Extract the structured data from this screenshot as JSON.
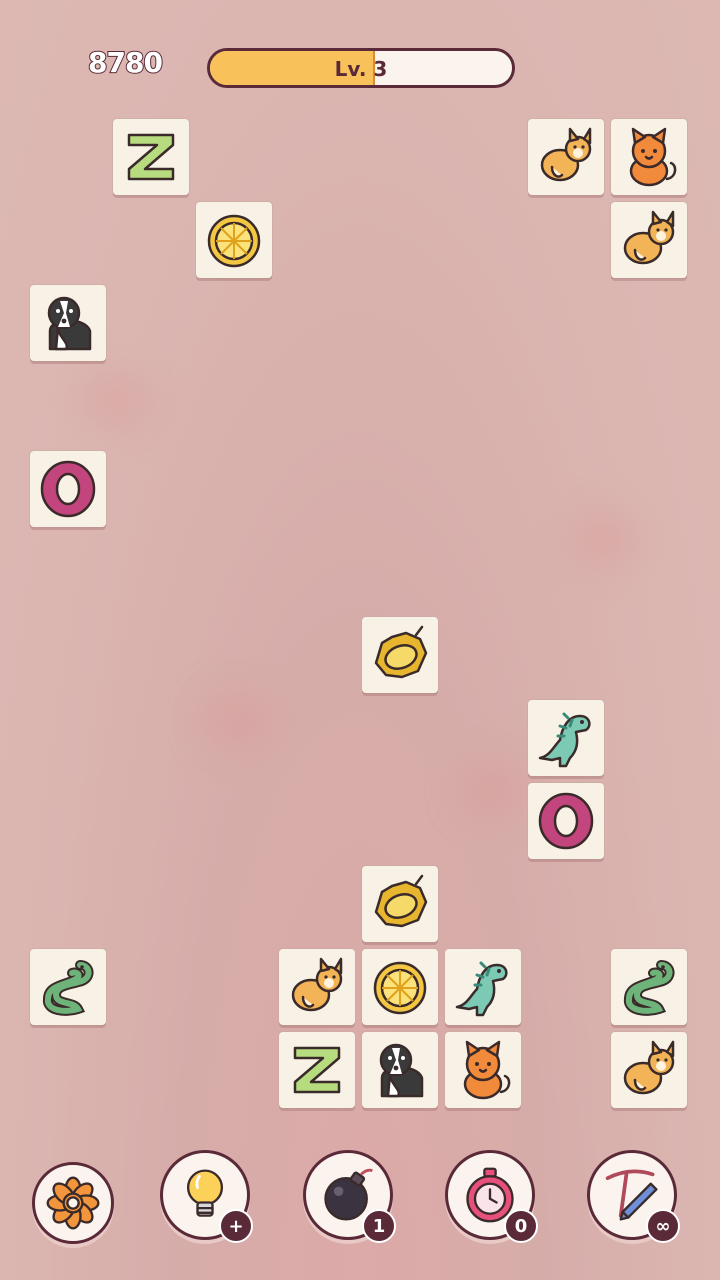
{
  "score": "8780",
  "level": {
    "label": "Lv. 3",
    "progress": 0.54
  },
  "tiles": [
    {
      "id": "t1",
      "col": 1,
      "row": 0,
      "icon": "letter-z-icon"
    },
    {
      "id": "t2",
      "col": 6,
      "row": 0,
      "icon": "corgi-icon"
    },
    {
      "id": "t3",
      "col": 7,
      "row": 0,
      "icon": "cat-icon"
    },
    {
      "id": "t4",
      "col": 2,
      "row": 1,
      "icon": "lemon-icon"
    },
    {
      "id": "t5",
      "col": 7,
      "row": 1,
      "icon": "corgi-icon"
    },
    {
      "id": "t6",
      "col": 0,
      "row": 2,
      "icon": "collie-icon"
    },
    {
      "id": "t7",
      "col": 0,
      "row": 4,
      "icon": "letter-o-icon"
    },
    {
      "id": "t8",
      "col": 4,
      "row": 6,
      "icon": "durian-icon"
    },
    {
      "id": "t9",
      "col": 6,
      "row": 7,
      "icon": "dinosaur-icon"
    },
    {
      "id": "t10",
      "col": 6,
      "row": 8,
      "icon": "letter-o-icon"
    },
    {
      "id": "t11",
      "col": 4,
      "row": 9,
      "icon": "durian-icon"
    },
    {
      "id": "t12",
      "col": 0,
      "row": 10,
      "icon": "snake-icon"
    },
    {
      "id": "t13",
      "col": 3,
      "row": 10,
      "icon": "corgi-icon"
    },
    {
      "id": "t14",
      "col": 4,
      "row": 10,
      "icon": "lemon-icon"
    },
    {
      "id": "t15",
      "col": 5,
      "row": 10,
      "icon": "dinosaur-icon"
    },
    {
      "id": "t16",
      "col": 7,
      "row": 10,
      "icon": "snake-icon"
    },
    {
      "id": "t17",
      "col": 3,
      "row": 11,
      "icon": "letter-z-icon"
    },
    {
      "id": "t18",
      "col": 4,
      "row": 11,
      "icon": "collie-icon"
    },
    {
      "id": "t19",
      "col": 5,
      "row": 11,
      "icon": "cat-icon"
    },
    {
      "id": "t20",
      "col": 7,
      "row": 11,
      "icon": "corgi-icon"
    }
  ],
  "tools": [
    {
      "name": "settings-button",
      "icon": "gear-icon",
      "badge": ""
    },
    {
      "name": "hint-button",
      "icon": "lightbulb-icon",
      "badge": "+"
    },
    {
      "name": "bomb-button",
      "icon": "bomb-icon",
      "badge": "1"
    },
    {
      "name": "timer-button",
      "icon": "stopwatch-icon",
      "badge": "0"
    },
    {
      "name": "pen-button",
      "icon": "pen-icon",
      "badge": "∞"
    }
  ]
}
